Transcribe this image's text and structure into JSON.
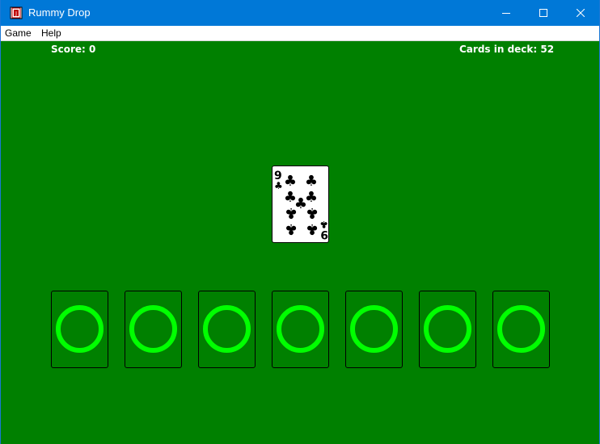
{
  "window": {
    "title": "Rummy Drop",
    "icon": "card-deck-app-icon",
    "controls": [
      "minimize-icon",
      "maximize-icon",
      "close-icon"
    ]
  },
  "menu": {
    "items": [
      {
        "label": "Game"
      },
      {
        "label": "Help"
      }
    ]
  },
  "hud": {
    "score_text": "Score: 0",
    "deck_text": "Cards in deck: 52"
  },
  "current_card": {
    "rank": "9",
    "suit": "clubs",
    "suit_symbol": "♣"
  },
  "drop_slots": {
    "count": 7,
    "state": "empty",
    "marker": "circle-icon"
  },
  "colors": {
    "table": "#008000",
    "titlebar": "#0078d7",
    "slot_marker": "#00ff00",
    "card_face": "#ffffff"
  }
}
